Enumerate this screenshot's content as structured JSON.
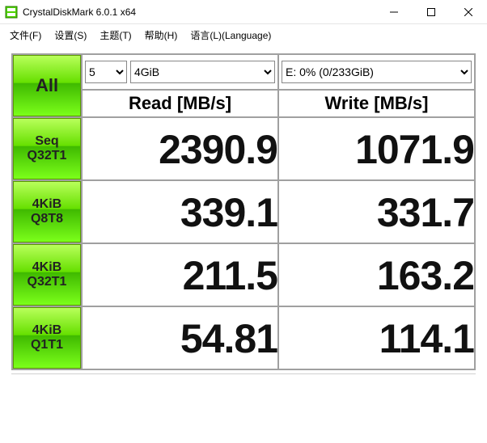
{
  "window": {
    "title": "CrystalDiskMark 6.0.1 x64"
  },
  "menu": {
    "file": "文件(F)",
    "settings": "设置(S)",
    "theme": "主题(T)",
    "help": "帮助(H)",
    "language": "语言(L)(Language)"
  },
  "controls": {
    "all_button": "All",
    "runs_selected": "5",
    "size_selected": "4GiB",
    "drive_selected": "E: 0% (0/233GiB)"
  },
  "headers": {
    "read": "Read [MB/s]",
    "write": "Write [MB/s]"
  },
  "tests": [
    {
      "label_line1": "Seq",
      "label_line2": "Q32T1",
      "read": "2390.9",
      "write": "1071.9"
    },
    {
      "label_line1": "4KiB",
      "label_line2": "Q8T8",
      "read": "339.1",
      "write": "331.7"
    },
    {
      "label_line1": "4KiB",
      "label_line2": "Q32T1",
      "read": "211.5",
      "write": "163.2"
    },
    {
      "label_line1": "4KiB",
      "label_line2": "Q1T1",
      "read": "54.81",
      "write": "114.1"
    }
  ],
  "chart_data": {
    "type": "table",
    "title": "CrystalDiskMark 6.0.1 x64",
    "columns": [
      "Test",
      "Read [MB/s]",
      "Write [MB/s]"
    ],
    "rows": [
      [
        "Seq Q32T1",
        2390.9,
        1071.9
      ],
      [
        "4KiB Q8T8",
        339.1,
        331.7
      ],
      [
        "4KiB Q32T1",
        211.5,
        163.2
      ],
      [
        "4KiB Q1T1",
        54.81,
        114.1
      ]
    ],
    "drive": "E: 0% (0/233GiB)",
    "test_size": "4GiB",
    "runs": 5
  }
}
